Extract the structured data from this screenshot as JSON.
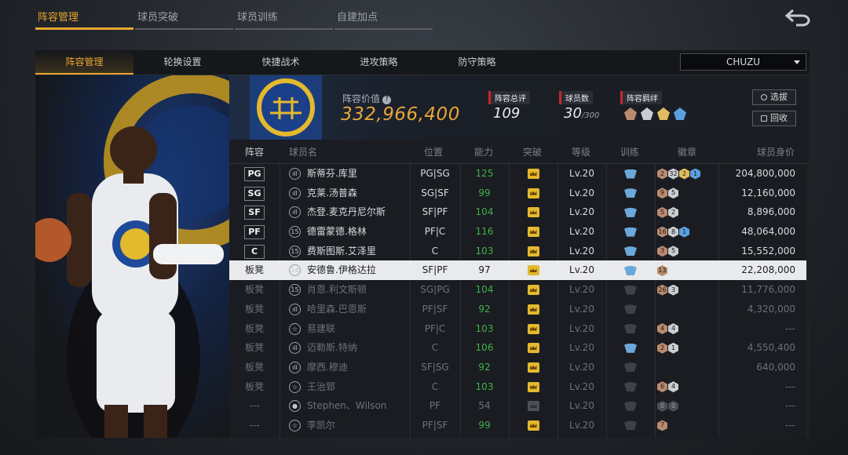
{
  "top_tabs": [
    "阵容管理",
    "球员突破",
    "球员训练",
    "自建加点"
  ],
  "sub_tabs": [
    "阵容管理",
    "轮换设置",
    "快捷战术",
    "进攻策略",
    "防守策略"
  ],
  "team_select": "CHUZU",
  "lineup_value_label": "阵容价值",
  "lineup_value": "332,966,400",
  "stats": {
    "rating_label": "阵容总评",
    "rating": "109",
    "players_label": "球员数",
    "players": "30",
    "players_max": "/300",
    "chem_label": "阵容羁绊"
  },
  "buttons": {
    "draft": "选拔",
    "recycle": "回收"
  },
  "columns": [
    "阵容",
    "球员名",
    "位置",
    "能力",
    "突破",
    "等级",
    "训练",
    "徽章",
    "球员身价"
  ],
  "rows": [
    {
      "role": "PG",
      "rate": "ıll",
      "name": "斯蒂芬.库里",
      "pos": "PG|SG",
      "ability": "125",
      "green": true,
      "crown": true,
      "level": "Lv.20",
      "train": true,
      "badges": [
        [
          "b-bronze",
          "2"
        ],
        [
          "b-silver",
          "32"
        ],
        [
          "b-gold",
          "2"
        ],
        [
          "b-blue",
          "1"
        ]
      ],
      "price": "204,800,000"
    },
    {
      "role": "SG",
      "rate": "ıll",
      "name": "克莱.汤普森",
      "pos": "SG|SF",
      "ability": "99",
      "green": true,
      "crown": true,
      "level": "Lv.20",
      "train": true,
      "badges": [
        [
          "b-bronze",
          "9"
        ],
        [
          "b-silver",
          "5"
        ]
      ],
      "price": "12,160,000"
    },
    {
      "role": "SF",
      "rate": "ıll",
      "name": "杰登.麦克丹尼尔斯",
      "pos": "SF|PF",
      "ability": "104",
      "green": true,
      "crown": true,
      "level": "Lv.20",
      "train": true,
      "badges": [
        [
          "b-bronze",
          "5"
        ],
        [
          "b-silver",
          "2"
        ]
      ],
      "price": "8,896,000"
    },
    {
      "role": "PF",
      "rate": "15",
      "name": "德雷蒙德.格林",
      "pos": "PF|C",
      "ability": "116",
      "green": true,
      "crown": true,
      "level": "Lv.20",
      "train": true,
      "badges": [
        [
          "b-bronze",
          "16"
        ],
        [
          "b-silver",
          "8"
        ],
        [
          "b-blue",
          "1"
        ]
      ],
      "price": "48,064,000"
    },
    {
      "role": "C",
      "rate": "15",
      "name": "费斯图斯.艾泽里",
      "pos": "C",
      "ability": "103",
      "green": true,
      "crown": true,
      "level": "Lv.20",
      "train": true,
      "badges": [
        [
          "b-bronze",
          "3"
        ],
        [
          "b-silver",
          "5"
        ]
      ],
      "price": "15,552,000"
    },
    {
      "role": "板凳",
      "rate": "14",
      "name": "安德鲁.伊格达拉",
      "pos": "SF|PF",
      "ability": "97",
      "green": false,
      "crown": true,
      "level": "Lv.20",
      "train": true,
      "badges": [
        [
          "b-bronze",
          "13"
        ]
      ],
      "price": "22,208,000",
      "selected": true
    },
    {
      "role": "板凳",
      "rate": "15",
      "name": "肖恩.利文斯顿",
      "pos": "SG|PG",
      "ability": "104",
      "green": true,
      "crown": true,
      "level": "Lv.20",
      "train": false,
      "badges": [
        [
          "b-bronze",
          "26"
        ],
        [
          "b-silver",
          "3"
        ]
      ],
      "price": "11,776,000",
      "dim": true
    },
    {
      "role": "板凳",
      "rate": "ıll",
      "name": "哈里森.巴恩斯",
      "pos": "PF|SF",
      "ability": "92",
      "green": true,
      "crown": true,
      "level": "Lv.20",
      "train": false,
      "badges": [],
      "price": "4,320,000",
      "dim": true
    },
    {
      "role": "板凳",
      "rate": "☆",
      "name": "易建联",
      "pos": "PF|C",
      "ability": "103",
      "green": true,
      "crown": true,
      "level": "Lv.20",
      "train": false,
      "badges": [
        [
          "b-bronze",
          "4"
        ],
        [
          "b-silver",
          "4"
        ]
      ],
      "price": "---",
      "dim": true
    },
    {
      "role": "板凳",
      "rate": "ıll",
      "name": "迈勒斯.特纳",
      "pos": "C",
      "ability": "106",
      "green": true,
      "crown": true,
      "level": "Lv.20",
      "train": true,
      "badges": [
        [
          "b-bronze",
          "2"
        ],
        [
          "b-silver",
          "1"
        ]
      ],
      "price": "4,550,400",
      "dim": true
    },
    {
      "role": "板凳",
      "rate": "ıll",
      "name": "摩西.穆迪",
      "pos": "SF|SG",
      "ability": "92",
      "green": true,
      "crown": true,
      "level": "Lv.20",
      "train": false,
      "badges": [],
      "price": "640,000",
      "dim": true
    },
    {
      "role": "板凳",
      "rate": "☆",
      "name": "王治郅",
      "pos": "C",
      "ability": "103",
      "green": true,
      "crown": true,
      "level": "Lv.20",
      "train": false,
      "badges": [
        [
          "b-bronze",
          "6"
        ],
        [
          "b-silver",
          "4"
        ]
      ],
      "price": "---",
      "dim": true
    },
    {
      "role": "---",
      "rate": "●",
      "name": "Stephen、Wilson",
      "pos": "PF",
      "ability": "54",
      "green": false,
      "crown": false,
      "level": "Lv.20",
      "train": false,
      "badges": [
        [
          "b-dark",
          "0"
        ],
        [
          "b-dark",
          "0"
        ]
      ],
      "price": "---",
      "dim": true
    },
    {
      "role": "---",
      "rate": "☆",
      "name": "李凯尔",
      "pos": "PF|SF",
      "ability": "99",
      "green": true,
      "crown": true,
      "level": "Lv.20",
      "train": false,
      "badges": [
        [
          "b-bronze",
          "7"
        ]
      ],
      "price": "---",
      "dim": true
    }
  ],
  "colors": {
    "accent": "#e8a731",
    "green": "#3fb14a",
    "train_blue": "#6ba8d9",
    "red_tag": "#c8262c"
  }
}
